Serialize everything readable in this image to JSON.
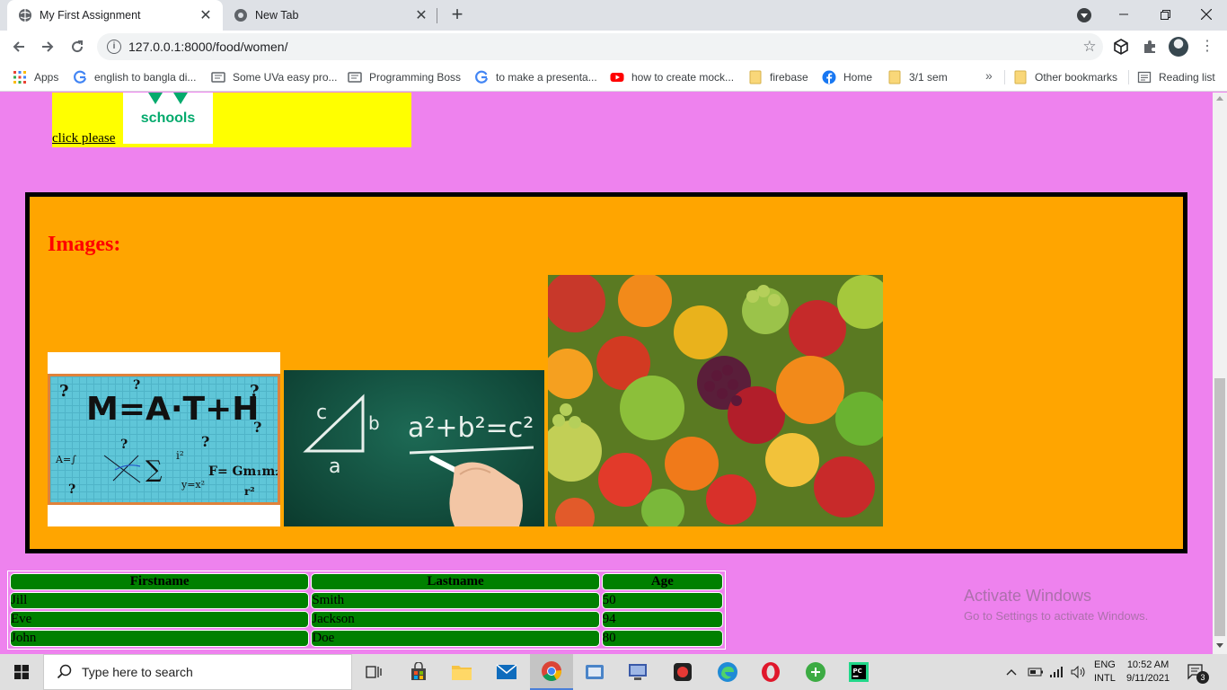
{
  "browser": {
    "tabs": [
      {
        "title": "My First Assignment",
        "active": true
      },
      {
        "title": "New Tab",
        "active": false
      }
    ],
    "url": "127.0.0.1:8000/food/women/",
    "bookmarks": [
      {
        "label": "Apps",
        "icon": "apps-grid-icon"
      },
      {
        "label": "english to bangla di...",
        "icon": "google-icon"
      },
      {
        "label": "Some UVa easy pro...",
        "icon": "page-icon"
      },
      {
        "label": "Programming Boss",
        "icon": "page-icon"
      },
      {
        "label": "to make a presenta...",
        "icon": "google-icon"
      },
      {
        "label": "how to create mock...",
        "icon": "youtube-icon"
      },
      {
        "label": "firebase",
        "icon": "folder-icon"
      },
      {
        "label": "Home",
        "icon": "facebook-icon"
      },
      {
        "label": "3/1 sem",
        "icon": "folder-icon"
      }
    ],
    "bookmarks_more": "»",
    "other_bookmarks": "Other bookmarks",
    "reading_list": "Reading list"
  },
  "page": {
    "logo_text": "schools",
    "link_text": "click please",
    "images_heading": "Images:",
    "math_image": {
      "title": "M=A·T+H"
    },
    "chalk_image": {
      "formula": "a²+b²=c²"
    },
    "table": {
      "headers": [
        "Firstname",
        "Lastname",
        "Age"
      ],
      "rows": [
        [
          "Jill",
          "Smith",
          "50"
        ],
        [
          "Eve",
          "Jackson",
          "94"
        ],
        [
          "John",
          "Doe",
          "80"
        ]
      ]
    },
    "watermark": {
      "line1": "Activate Windows",
      "line2": "Go to Settings to activate Windows."
    }
  },
  "taskbar": {
    "search_placeholder": "Type here to search",
    "lang_top": "ENG",
    "lang_bottom": "INTL",
    "time": "10:52 AM",
    "date": "9/11/2021",
    "notification_count": "3"
  },
  "colors": {
    "page_bg": "#ee82ee",
    "yellow_box": "#ffff00",
    "orange_box": "#ffa500",
    "heading_red": "#ff0000",
    "table_cell": "#008000"
  }
}
